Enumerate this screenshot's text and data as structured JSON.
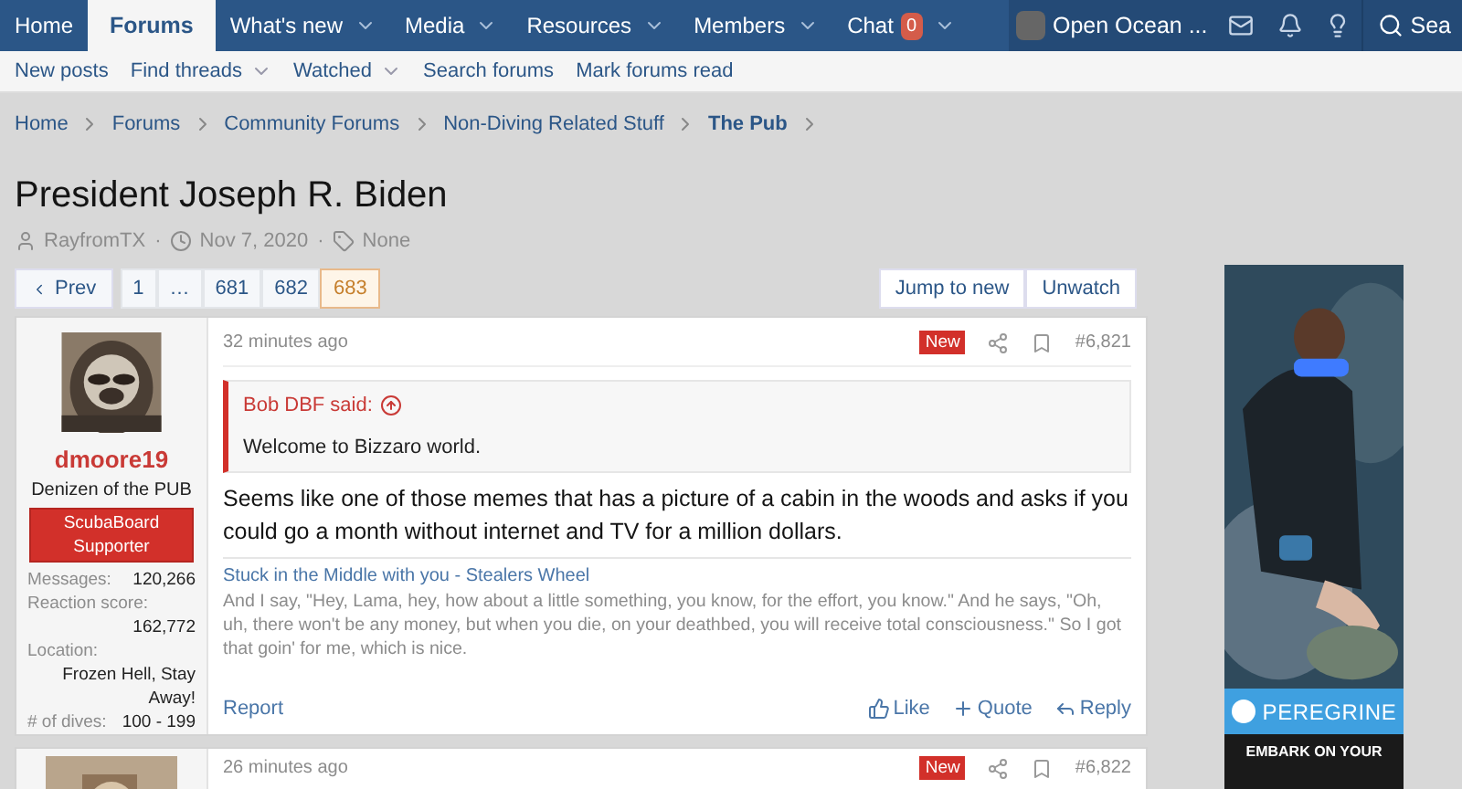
{
  "nav": {
    "tabs": [
      {
        "label": "Home",
        "selected": false,
        "dropdown": false
      },
      {
        "label": "Forums",
        "selected": true,
        "dropdown": false
      },
      {
        "label": "What's new",
        "selected": false,
        "dropdown": true
      },
      {
        "label": "Media",
        "selected": false,
        "dropdown": true
      },
      {
        "label": "Resources",
        "selected": false,
        "dropdown": true
      },
      {
        "label": "Members",
        "selected": false,
        "dropdown": true
      },
      {
        "label": "Chat",
        "selected": false,
        "dropdown": true,
        "badge": "0"
      }
    ],
    "account": "Open Ocean ...",
    "search": "Sea"
  },
  "subnav": [
    {
      "label": "New posts",
      "dropdown": false
    },
    {
      "label": "Find threads",
      "dropdown": true
    },
    {
      "label": "Watched",
      "dropdown": true
    },
    {
      "label": "Search forums",
      "dropdown": false
    },
    {
      "label": "Mark forums read",
      "dropdown": false
    }
  ],
  "breadcrumb": [
    {
      "label": "Home",
      "current": false
    },
    {
      "label": "Forums",
      "current": false
    },
    {
      "label": "Community Forums",
      "current": false
    },
    {
      "label": "Non-Diving Related Stuff",
      "current": false
    },
    {
      "label": "The Pub",
      "current": true
    }
  ],
  "thread": {
    "title": "President Joseph R. Biden",
    "author": "RayfromTX",
    "date": "Nov 7, 2020",
    "tags": "None",
    "separator": "·"
  },
  "pagination": {
    "prev": "Prev",
    "pages": [
      {
        "label": "1",
        "selected": false
      },
      {
        "label": "…",
        "selected": false
      },
      {
        "label": "681",
        "selected": false
      },
      {
        "label": "682",
        "selected": false
      },
      {
        "label": "683",
        "selected": true
      }
    ],
    "actions": [
      "Jump to new",
      "Unwatch"
    ]
  },
  "posts": [
    {
      "time": "32 minutes ago",
      "badge": "New",
      "number": "#6,821",
      "username": "dmoore19",
      "user_title": "Denizen of the PUB",
      "banner": "ScubaBoard Supporter",
      "stats": [
        {
          "label": "Messages:",
          "value": "120,266",
          "stacked": false
        },
        {
          "label": "Reaction score:",
          "value": "162,772",
          "stacked": true
        },
        {
          "label": "Location:",
          "value": "Frozen Hell, Stay Away!",
          "stacked": true
        },
        {
          "label": "# of dives:",
          "value": "100 - 199",
          "stacked": false
        }
      ],
      "quote": {
        "author": "Bob DBF said:",
        "text": "Welcome to Bizzaro world."
      },
      "body": "Seems like one of those memes that has a picture of a cabin in the woods and asks if you could go a month without internet and TV for a million dollars.",
      "signature": {
        "title": "Stuck in the Middle with you - Stealers Wheel",
        "text": "And I say, \"Hey, Lama, hey, how about a little something, you know, for the effort, you know.\" And he says, \"Oh, uh, there won't be any money, but when you die, on your deathbed, you will receive total consciousness.\" So I got that goin' for me, which is nice."
      },
      "report": "Report",
      "actions": [
        "Like",
        "Quote",
        "Reply"
      ]
    },
    {
      "time": "26 minutes ago",
      "badge": "New",
      "number": "#6,822"
    }
  ],
  "ad": {
    "brand": "PEREGRINE",
    "tagline": "EMBARK ON YOUR"
  }
}
